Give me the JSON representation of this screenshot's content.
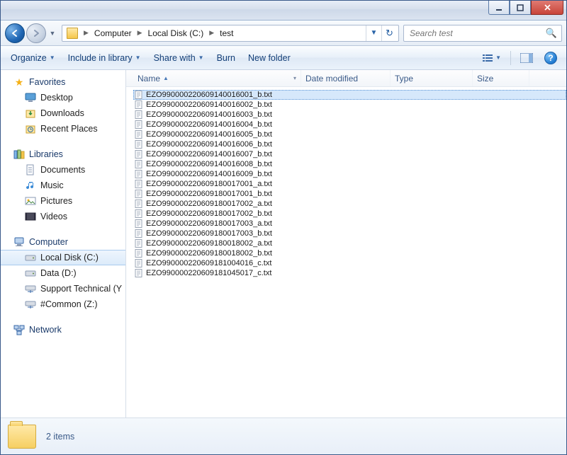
{
  "titlebar": {},
  "nav": {
    "breadcrumb": [
      "Computer",
      "Local Disk (C:)",
      "test"
    ],
    "search_placeholder": "Search test"
  },
  "toolbar": {
    "organize": "Organize",
    "include": "Include in library",
    "share": "Share with",
    "burn": "Burn",
    "newfolder": "New folder"
  },
  "columns": {
    "name": "Name",
    "date": "Date modified",
    "type": "Type",
    "size": "Size"
  },
  "sidebar": {
    "favorites": {
      "label": "Favorites",
      "items": [
        {
          "label": "Desktop",
          "icon": "desktop"
        },
        {
          "label": "Downloads",
          "icon": "downloads"
        },
        {
          "label": "Recent Places",
          "icon": "recent"
        }
      ]
    },
    "libraries": {
      "label": "Libraries",
      "items": [
        {
          "label": "Documents",
          "icon": "doc"
        },
        {
          "label": "Music",
          "icon": "music"
        },
        {
          "label": "Pictures",
          "icon": "pic"
        },
        {
          "label": "Videos",
          "icon": "vid"
        }
      ]
    },
    "computer": {
      "label": "Computer",
      "items": [
        {
          "label": "Local Disk (C:)",
          "icon": "drive",
          "selected": true
        },
        {
          "label": "Data (D:)",
          "icon": "drive"
        },
        {
          "label": "Support Technical (Y",
          "icon": "netdrive"
        },
        {
          "label": "#Common (Z:)",
          "icon": "netdrive"
        }
      ]
    },
    "network": {
      "label": "Network"
    }
  },
  "files": [
    "EZO990000220609140016001_b.txt",
    "EZO990000220609140016002_b.txt",
    "EZO990000220609140016003_b.txt",
    "EZO990000220609140016004_b.txt",
    "EZO990000220609140016005_b.txt",
    "EZO990000220609140016006_b.txt",
    "EZO990000220609140016007_b.txt",
    "EZO990000220609140016008_b.txt",
    "EZO990000220609140016009_b.txt",
    "EZO990000220609180017001_a.txt",
    "EZO990000220609180017001_b.txt",
    "EZO990000220609180017002_a.txt",
    "EZO990000220609180017002_b.txt",
    "EZO990000220609180017003_a.txt",
    "EZO990000220609180017003_b.txt",
    "EZO990000220609180018002_a.txt",
    "EZO990000220609180018002_b.txt",
    "EZO990000220609181004016_c.txt",
    "EZO990000220609181045017_c.txt"
  ],
  "status": {
    "text": "2 items"
  }
}
